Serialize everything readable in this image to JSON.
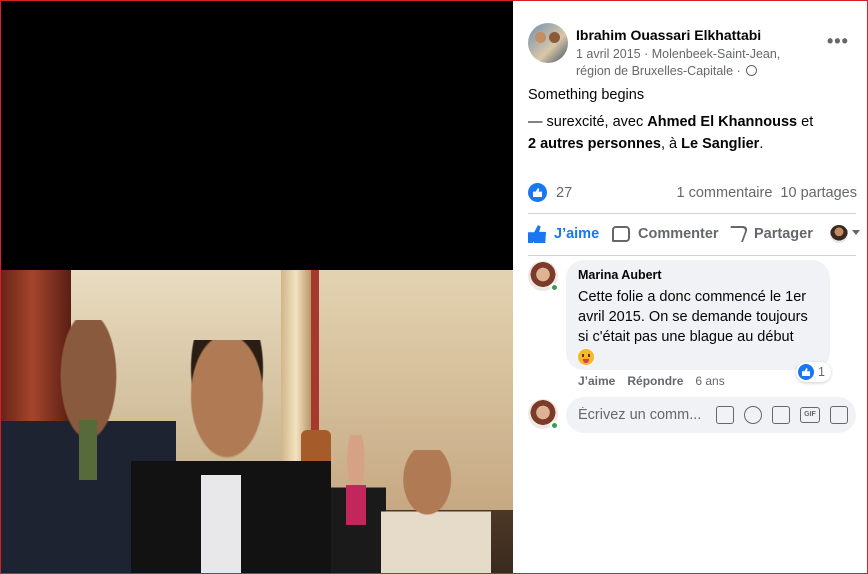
{
  "post": {
    "author": "Ibrahim Ouassari Elkhattabi",
    "meta_line1": "1 avril 2015 · Molenbeek-Saint-Jean,",
    "meta_line2": "région de Bruxelles-Capitale ·",
    "privacy_icon": "globe-icon",
    "more_label": "•••",
    "caption": "Something begins",
    "tag_prefix": "— surexcité, avec ",
    "tag_person": "Ahmed El Khannouss",
    "tag_and": " et",
    "tag_others": "2 autres personnes",
    "tag_at": ", à ",
    "tag_place": "Le Sanglier",
    "tag_end": "."
  },
  "stats": {
    "likes": "27",
    "comments": "1 commentaire",
    "shares": "10 partages"
  },
  "actions": {
    "like": "J’aime",
    "comment": "Commenter",
    "share": "Partager"
  },
  "comment": {
    "author": "Marina Aubert",
    "text": "Cette folie a donc commencé le 1er avril 2015. On se demande toujours si c'était pas une blague au début",
    "reaction_count": "1",
    "like_label": "J’aime",
    "reply_label": "Répondre",
    "time": "6 ans"
  },
  "composer": {
    "placeholder": "Écrivez un comm..."
  },
  "colors": {
    "accent": "#1877f2",
    "online": "#31a24c",
    "muted": "#65676b"
  }
}
